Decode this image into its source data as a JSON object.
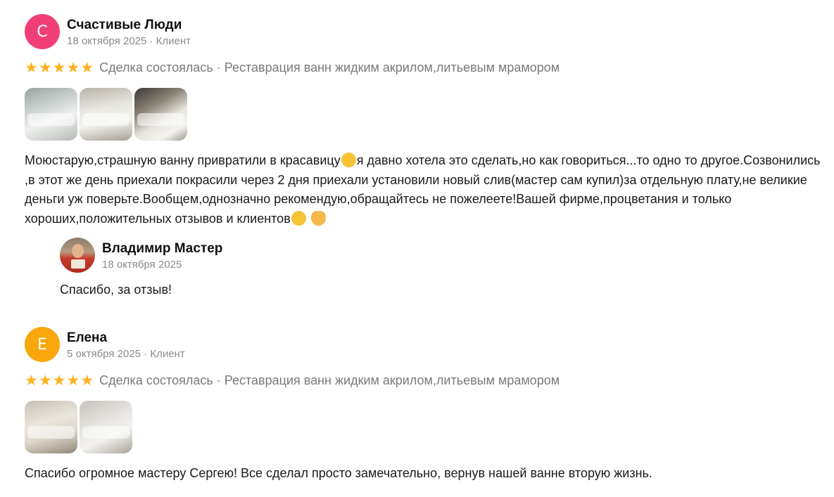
{
  "reviews": [
    {
      "avatar_letter": "С",
      "avatar_color": "#f03e76",
      "name": "Счастивые Люди",
      "meta": "18 октября 2025 · Клиент",
      "stars": 5,
      "deal": "Сделка состоялась · Реставрация ванн жидким акрилом,литьевым мрамором",
      "text_part1": "Моюстарую,страшную ванну привратили в красавицу",
      "text_part2": "я давно хотела это сделать,но как говориться...то одно то другое.Созвонились ,в этот же день приехали покрасили через 2 дня приехали установили новый слив(мастер сам купил)за отдельную плату,не великие деньги уж поверьте.Вообщем,однозначно рекомендую,обращайтесь не пожелеете!Вашей фирме,процветания и только хороших,положительных отзывов и клиентов",
      "reply": {
        "name": "Владимир Мастер",
        "date": "18 октября 2025",
        "text": "Спасибо, за отзыв!"
      }
    },
    {
      "avatar_letter": "Е",
      "avatar_color": "#f9a60a",
      "name": "Елена",
      "meta": "5 октября 2025 · Клиент",
      "stars": 5,
      "deal": "Сделка состоялась · Реставрация ванн жидким акрилом,литьевым мрамором",
      "text": "Спасибо огромное мастеру Сергею! Все сделал просто замечательно, вернув нашей ванне вторую жизнь."
    }
  ],
  "colors": {
    "star": "#ffb021",
    "muted_text": "#8a8a8a"
  }
}
